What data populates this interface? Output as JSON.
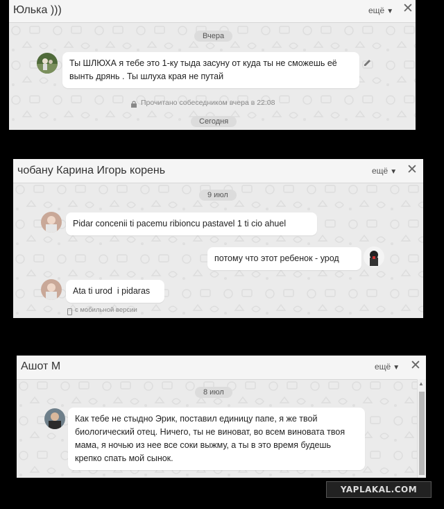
{
  "panels": [
    {
      "title": "Юлька )))",
      "more_label": "ещё",
      "date_label": "Вчера",
      "message": "Ты ШЛЮХА я тебе это 1-ку тыда засуну от куда ты не сможешь её вынть дрянь . Ты шлуха края не путай",
      "read_status": "Прочитано собеседником вчера в 22:08",
      "bottom_label": "Сегодня"
    },
    {
      "title": "чобану Карина Игорь корень",
      "more_label": "ещё",
      "date_label": "9 июл",
      "messages": [
        {
          "text": "Pidar concenii ti pacemu ribioncu pastavel 1 ti cio ahuel"
        },
        {
          "text": "потому что этот ребенок - урод"
        },
        {
          "text": "Ata ti urod  i pidaras"
        }
      ],
      "mobile_label": "с мобильной версии"
    },
    {
      "title": "Ашот М",
      "more_label": "ещё",
      "date_label": "8 июл",
      "message": "Как тебе не стыдно Эрик, поставил единицу папе, я же твой биологический отец. Ничего, ты не виноват, во всем виновата твоя мама, я ночью из нее все соки выжму, а ты в это время будешь крепко спать мой сынок."
    }
  ],
  "watermark": "YAPLAKAL.COM"
}
